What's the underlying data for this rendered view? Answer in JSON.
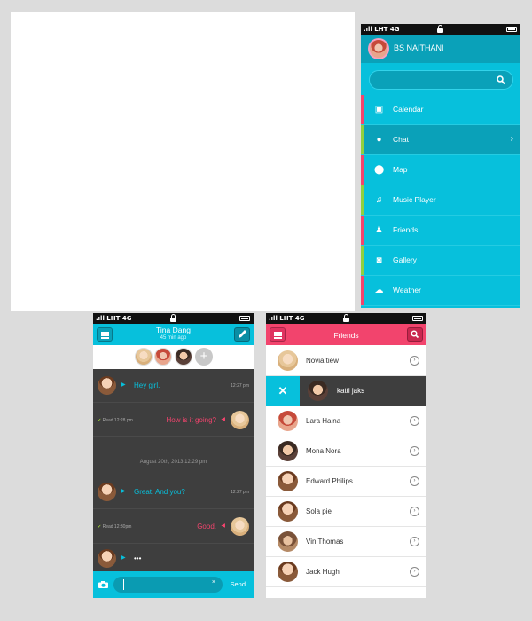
{
  "status_bar": {
    "carrier": "LHT",
    "network": "4G"
  },
  "sidebar": {
    "profile_name": "BS NAITHANI",
    "items": [
      {
        "label": "Calendar",
        "icon": "calendar-icon",
        "stripe": "#f2446d"
      },
      {
        "label": "Chat",
        "icon": "chat-bubble-icon",
        "stripe": "#8fd13f",
        "active": true
      },
      {
        "label": "Map",
        "icon": "map-pin-icon",
        "stripe": "#f2446d"
      },
      {
        "label": "Music Player",
        "icon": "music-note-icon",
        "stripe": "#8fd13f"
      },
      {
        "label": "Friends",
        "icon": "person-icon",
        "stripe": "#f2446d"
      },
      {
        "label": "Gallery",
        "icon": "camera-icon",
        "stripe": "#8fd13f"
      },
      {
        "label": "Weather",
        "icon": "cloud-icon",
        "stripe": "#f2446d"
      }
    ]
  },
  "chat": {
    "title": "Tina Dang",
    "subtitle": "45 min ago",
    "messages": [
      {
        "text": "Hey girl.",
        "time": "12:27 pm",
        "side": "left"
      },
      {
        "text": "How is it going?",
        "read": "Read 12:28 pm",
        "side": "right"
      },
      {
        "text": "Great. And you?",
        "time": "12:27 pm",
        "side": "left"
      },
      {
        "text": "Good.",
        "read": "Read 12:30pm",
        "side": "right"
      },
      {
        "text": "•••",
        "side": "left"
      }
    ],
    "date_separator": "August 20th, 2013    12:29 pm",
    "send_label": "Send",
    "clear_glyph": "×"
  },
  "friends": {
    "title": "Friends",
    "swiped_name": "katti jaks",
    "delete_glyph": "✕",
    "list": [
      "Novia tiew",
      "Lara Haina",
      "Mona Nora",
      "Edward Philips",
      "Sola pie",
      "Vin Thomas",
      "Jack Hugh"
    ]
  },
  "colors": {
    "cyan": "#07c0dc",
    "cyan_dark": "#0aa1b9",
    "pink": "#f2446d",
    "green": "#8fd13f",
    "chat_bg": "#3e3e3e"
  }
}
